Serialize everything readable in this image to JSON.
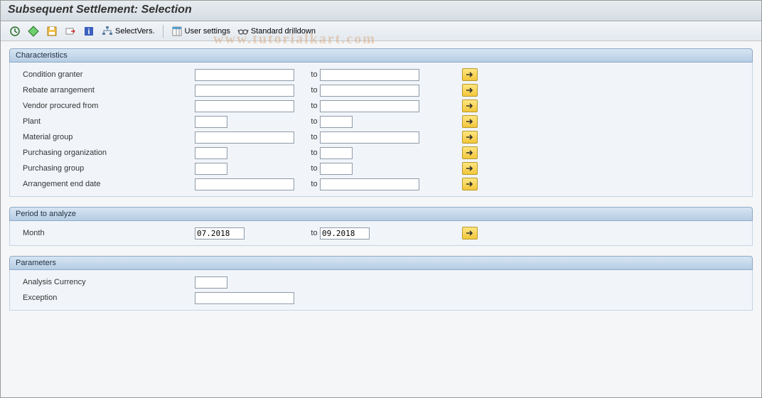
{
  "title": "Subsequent Settlement: Selection",
  "toolbar": {
    "select_vers": "SelectVers.",
    "user_settings": "User settings",
    "standard_drilldown": "Standard drilldown"
  },
  "groups": {
    "characteristics": {
      "title": "Characteristics",
      "rows": {
        "condition_granter": {
          "label": "Condition granter",
          "from": "",
          "to_label": "to",
          "to": "",
          "size": "wide"
        },
        "rebate_arrangement": {
          "label": "Rebate arrangement",
          "from": "",
          "to_label": "to",
          "to": "",
          "size": "wide"
        },
        "vendor_procured_from": {
          "label": "Vendor procured from",
          "from": "",
          "to_label": "to",
          "to": "",
          "size": "wide"
        },
        "plant": {
          "label": "Plant",
          "from": "",
          "to_label": "to",
          "to": "",
          "size": "small"
        },
        "material_group": {
          "label": "Material group",
          "from": "",
          "to_label": "to",
          "to": "",
          "size": "wide"
        },
        "purchasing_org": {
          "label": "Purchasing organization",
          "from": "",
          "to_label": "to",
          "to": "",
          "size": "small"
        },
        "purchasing_group": {
          "label": "Purchasing group",
          "from": "",
          "to_label": "to",
          "to": "",
          "size": "small"
        },
        "arrangement_end_date": {
          "label": "Arrangement end date",
          "from": "",
          "to_label": "to",
          "to": "",
          "size": "wide"
        }
      }
    },
    "period": {
      "title": "Period to analyze",
      "rows": {
        "month": {
          "label": "Month",
          "from": "07.2018",
          "to_label": "to",
          "to": "09.2018",
          "size": "date"
        }
      }
    },
    "parameters": {
      "title": "Parameters",
      "rows": {
        "analysis_currency": {
          "label": "Analysis Currency",
          "value": "",
          "size": "small"
        },
        "exception": {
          "label": "Exception",
          "value": "",
          "size": "wide"
        }
      }
    }
  },
  "watermark": "www.tutorialkart.com"
}
